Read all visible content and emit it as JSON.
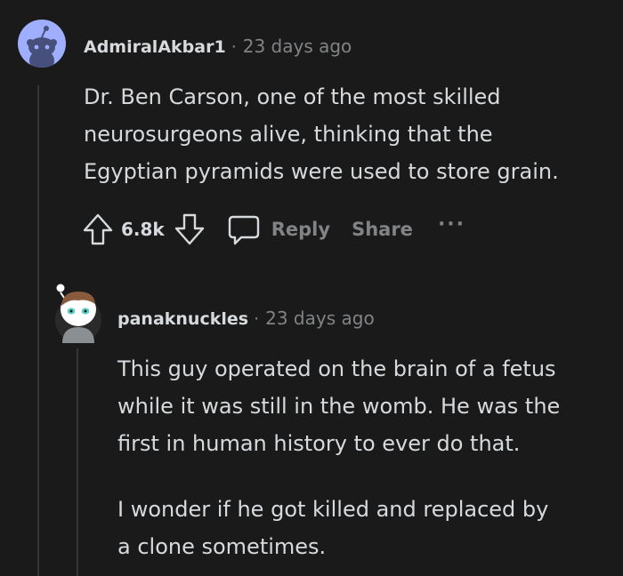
{
  "comment1": {
    "username": "AdmiralAkbar1",
    "separator": "·",
    "time": "23 days ago",
    "lines": [
      "Dr. Ben Carson, one of the most skilled",
      "neurosurgeons alive, thinking that the",
      "Egyptian pyramids were used to store grain."
    ],
    "votes": "6.8k",
    "reply_label": "Reply",
    "share_label": "Share",
    "more_label": "···"
  },
  "comment2": {
    "username": "panaknuckles",
    "separator": "·",
    "time": "23 days ago",
    "paragraph1": [
      "This guy operated on the brain of a fetus",
      "while it was still in the womb. He was the",
      "first in human history to ever do that."
    ],
    "paragraph2": [
      "I wonder if he got killed and replaced by",
      "a clone sometimes."
    ]
  },
  "colors": {
    "background": "#1a1a1b",
    "text": "#d7dadc",
    "muted": "#818384",
    "avatar1_bg": "#a0aeff"
  },
  "icons": {
    "avatar1": "snoo-avatar-icon",
    "avatar2": "user-avatar-icon",
    "upvote": "arrow-up-icon",
    "downvote": "arrow-down-icon",
    "reply": "speech-bubble-icon"
  }
}
